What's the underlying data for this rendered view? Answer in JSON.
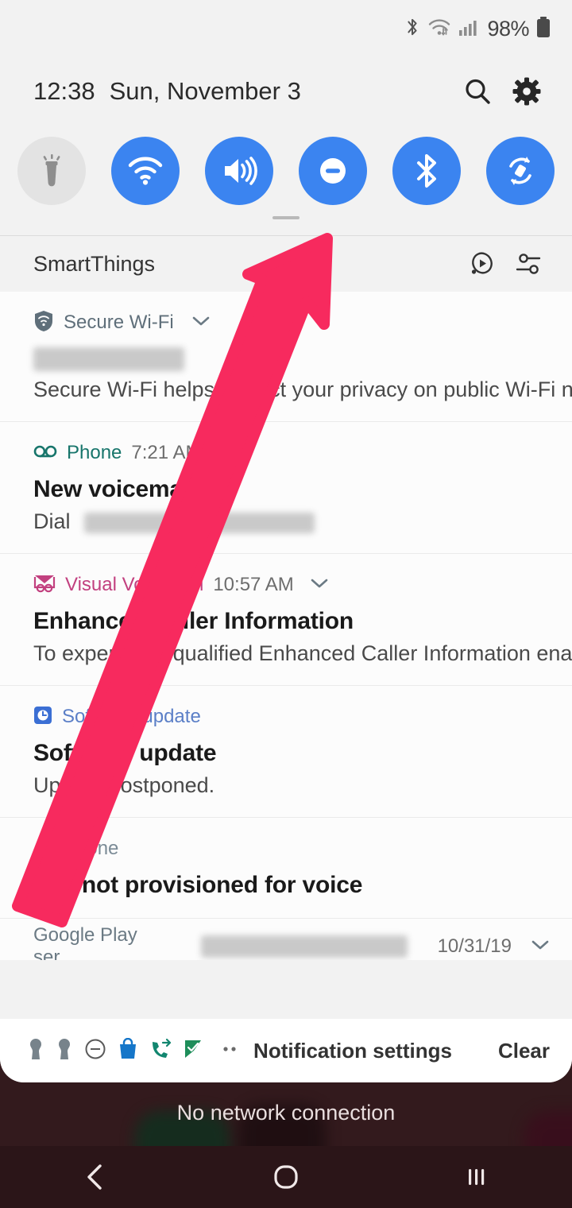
{
  "status_bar": {
    "icons": [
      "bluetooth-icon",
      "wifi-icon",
      "cellular-signal-icon"
    ],
    "battery_percent": "98%",
    "battery_icon": "battery-full-icon"
  },
  "header": {
    "clock": "12:38",
    "date": "Sun, November 3",
    "search_icon": "search-icon",
    "settings_icon": "gear-icon"
  },
  "quick_settings": {
    "toggles": [
      {
        "name": "flashlight",
        "label": "Flashlight",
        "icon": "flashlight-icon",
        "state": "off"
      },
      {
        "name": "wifi",
        "label": "Wi-Fi",
        "icon": "wifi-icon",
        "state": "on"
      },
      {
        "name": "sound",
        "label": "Sound",
        "icon": "volume-icon",
        "state": "on"
      },
      {
        "name": "do-not-disturb",
        "label": "Do not disturb",
        "icon": "minus-circle-icon",
        "state": "on"
      },
      {
        "name": "bluetooth",
        "label": "Bluetooth",
        "icon": "bluetooth-icon",
        "state": "on"
      },
      {
        "name": "auto-rotate",
        "label": "Auto rotate",
        "icon": "auto-rotate-icon",
        "state": "on"
      }
    ],
    "accent_on": "#3b84f0",
    "accent_off": "#e3e3e3"
  },
  "smartthings": {
    "label": "SmartThings",
    "media_icon": "media-cast-icon",
    "devices_icon": "device-controls-icon"
  },
  "notifications": [
    {
      "app": "Secure Wi-Fi",
      "app_color": "#5f6f7a",
      "icon": "secure-wifi-shield-icon",
      "time": "",
      "has_chevron": true,
      "title_redacted": true,
      "title": "",
      "body": "Secure Wi-Fi helps protect your privacy on public Wi-Fi n.."
    },
    {
      "app": "Phone",
      "app_color": "#17756b",
      "icon": "voicemail-icon",
      "time": "7:21 AM",
      "has_chevron": false,
      "title_redacted": false,
      "title": "New voicemail",
      "body": "Dial",
      "body_redacted": true
    },
    {
      "app": "Visual Voicemail",
      "app_color": "#c2407f",
      "icon": "visual-voicemail-icon",
      "time": "10:57 AM",
      "has_chevron": true,
      "title_redacted": false,
      "title": "Enhanced Caller Information",
      "body": "To experience qualified Enhanced Caller Information ena.."
    },
    {
      "app": "Software update",
      "app_color": "#5b7fc7",
      "icon": "software-update-icon",
      "time": "",
      "has_chevron": false,
      "title_redacted": false,
      "title": "Software update",
      "body": "Update postponed."
    },
    {
      "app": "Phone",
      "app_color": "#7b8b96",
      "icon": "alert-mm-icon",
      "time": "",
      "has_chevron": false,
      "title_redacted": false,
      "title": "SIM not provisioned for voice",
      "body": ""
    }
  ],
  "notification_clipped": {
    "app": "Google Play ser",
    "time": "10/31/19",
    "has_chevron": true,
    "redacted": true
  },
  "footer": {
    "silent_icons": [
      "keyhole-icon",
      "keyhole-icon",
      "minus-circle-icon",
      "shopping-bag-icon",
      "call-forward-icon",
      "check-flag-icon",
      "more-dots-icon"
    ],
    "notification_settings_label": "Notification settings",
    "clear_label": "Clear"
  },
  "home_screen": {
    "no_network_text": "No network connection"
  },
  "nav_bar": {
    "back_icon": "back-chevron-icon",
    "home_icon": "home-circle-icon",
    "recents_icon": "recents-bars-icon"
  },
  "annotation": {
    "arrow_color": "#f72a5e",
    "points_to": "do-not-disturb"
  }
}
